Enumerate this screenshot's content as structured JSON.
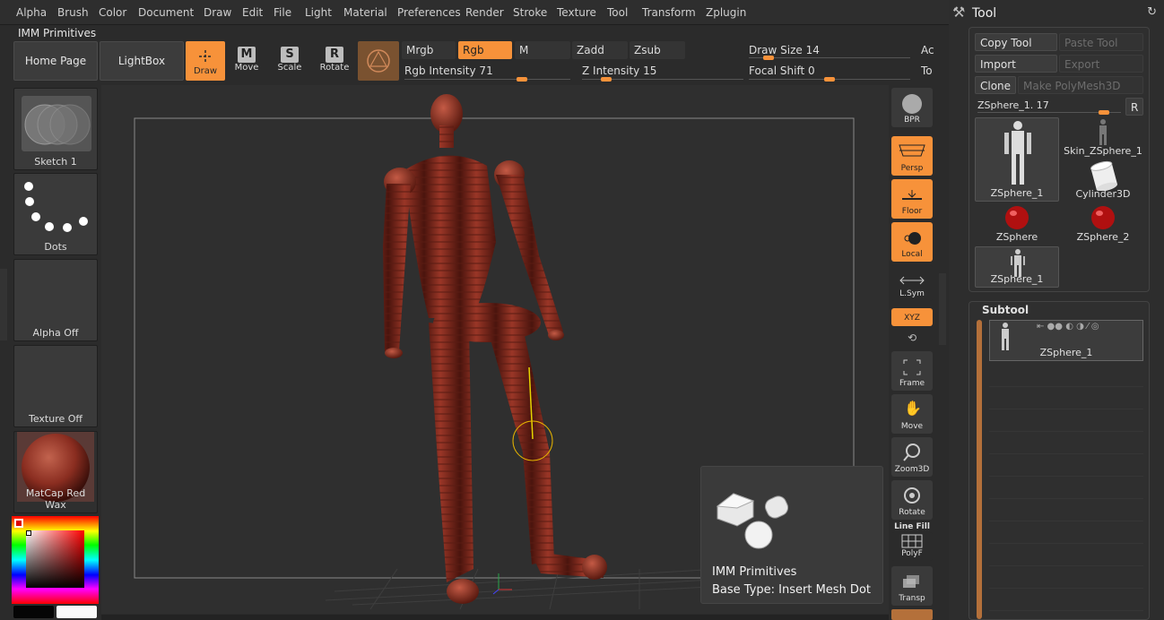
{
  "menu": [
    "Alpha",
    "Brush",
    "Color",
    "Document",
    "Draw",
    "Edit",
    "File",
    "Light",
    "Material",
    "Preferences",
    "Render",
    "Stroke",
    "Texture",
    "Tool",
    "Transform",
    "Zplugin"
  ],
  "palette_title": "IMM Primitives",
  "shelf": {
    "home_page": "Home Page",
    "lightbox": "LightBox",
    "draw": "Draw",
    "move": "Move",
    "scale": "Scale",
    "rotate": "Rotate",
    "move_glyph": "M",
    "scale_glyph": "S",
    "rotate_glyph": "R"
  },
  "color_toggles": {
    "mrgb": "Mrgb",
    "rgb": "Rgb",
    "m": "M",
    "zadd": "Zadd",
    "zsub": "Zsub"
  },
  "sliders": {
    "rgb_intensity": "Rgb Intensity 71",
    "z_intensity": "Z Intensity 15",
    "draw_size": "Draw Size 14",
    "focal_shift": "Focal Shift 0",
    "rgb_intensity_value": 0.71,
    "z_intensity_value": 0.15,
    "draw_size_value": 0.12,
    "focal_shift_value": 0.5,
    "cut_a": "Ac",
    "cut_b": "To"
  },
  "left_palette": {
    "stroke": "Sketch 1",
    "alpha_dots": "Dots",
    "alpha": "Alpha Off",
    "texture": "Texture Off",
    "material": "MatCap Red Wax"
  },
  "right_dock": {
    "bpr": "BPR",
    "persp": "Persp",
    "floor": "Floor",
    "local": "Local",
    "lsym": "L.Sym",
    "xyz": "XYZ",
    "frame": "Frame",
    "move": "Move",
    "zoom3d": "Zoom3D",
    "rotate": "Rotate",
    "line_fill": "Line Fill",
    "polyf": "PolyF",
    "transp": "Transp"
  },
  "tooltip": {
    "title": "IMM Primitives",
    "subtitle": "Base Type: Insert Mesh Dot"
  },
  "tool_panel": {
    "title": "Tool",
    "copy_tool": "Copy Tool",
    "paste_tool": "Paste Tool",
    "import": "Import",
    "export": "Export",
    "clone": "Clone",
    "make_polymesh": "Make PolyMesh3D",
    "slider_label": "ZSphere_1. 17",
    "slider_value": 0.88,
    "r_button": "R",
    "thumbs": [
      "ZSphere_1",
      "Skin_ZSphere_1",
      "Cylinder3D",
      "ZSphere",
      "ZSphere_2",
      "ZSphere_1"
    ],
    "subtool_title": "Subtool",
    "subtool_item": "ZSphere_1"
  },
  "colors": {
    "accent": "#f7923a",
    "model": "#8b2e22",
    "background": "#2b2b2b"
  }
}
